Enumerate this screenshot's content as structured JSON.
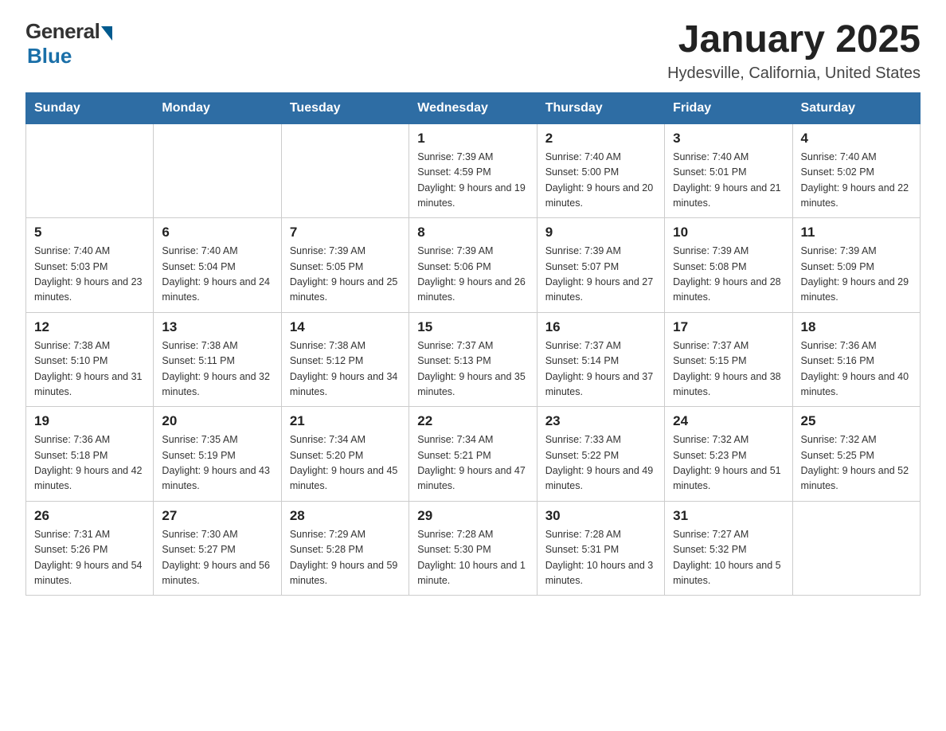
{
  "logo": {
    "general": "General",
    "blue": "Blue"
  },
  "title": "January 2025",
  "subtitle": "Hydesville, California, United States",
  "weekdays": [
    "Sunday",
    "Monday",
    "Tuesday",
    "Wednesday",
    "Thursday",
    "Friday",
    "Saturday"
  ],
  "weeks": [
    [
      null,
      null,
      null,
      {
        "day": "1",
        "sunrise": "Sunrise: 7:39 AM",
        "sunset": "Sunset: 4:59 PM",
        "daylight": "Daylight: 9 hours and 19 minutes."
      },
      {
        "day": "2",
        "sunrise": "Sunrise: 7:40 AM",
        "sunset": "Sunset: 5:00 PM",
        "daylight": "Daylight: 9 hours and 20 minutes."
      },
      {
        "day": "3",
        "sunrise": "Sunrise: 7:40 AM",
        "sunset": "Sunset: 5:01 PM",
        "daylight": "Daylight: 9 hours and 21 minutes."
      },
      {
        "day": "4",
        "sunrise": "Sunrise: 7:40 AM",
        "sunset": "Sunset: 5:02 PM",
        "daylight": "Daylight: 9 hours and 22 minutes."
      }
    ],
    [
      {
        "day": "5",
        "sunrise": "Sunrise: 7:40 AM",
        "sunset": "Sunset: 5:03 PM",
        "daylight": "Daylight: 9 hours and 23 minutes."
      },
      {
        "day": "6",
        "sunrise": "Sunrise: 7:40 AM",
        "sunset": "Sunset: 5:04 PM",
        "daylight": "Daylight: 9 hours and 24 minutes."
      },
      {
        "day": "7",
        "sunrise": "Sunrise: 7:39 AM",
        "sunset": "Sunset: 5:05 PM",
        "daylight": "Daylight: 9 hours and 25 minutes."
      },
      {
        "day": "8",
        "sunrise": "Sunrise: 7:39 AM",
        "sunset": "Sunset: 5:06 PM",
        "daylight": "Daylight: 9 hours and 26 minutes."
      },
      {
        "day": "9",
        "sunrise": "Sunrise: 7:39 AM",
        "sunset": "Sunset: 5:07 PM",
        "daylight": "Daylight: 9 hours and 27 minutes."
      },
      {
        "day": "10",
        "sunrise": "Sunrise: 7:39 AM",
        "sunset": "Sunset: 5:08 PM",
        "daylight": "Daylight: 9 hours and 28 minutes."
      },
      {
        "day": "11",
        "sunrise": "Sunrise: 7:39 AM",
        "sunset": "Sunset: 5:09 PM",
        "daylight": "Daylight: 9 hours and 29 minutes."
      }
    ],
    [
      {
        "day": "12",
        "sunrise": "Sunrise: 7:38 AM",
        "sunset": "Sunset: 5:10 PM",
        "daylight": "Daylight: 9 hours and 31 minutes."
      },
      {
        "day": "13",
        "sunrise": "Sunrise: 7:38 AM",
        "sunset": "Sunset: 5:11 PM",
        "daylight": "Daylight: 9 hours and 32 minutes."
      },
      {
        "day": "14",
        "sunrise": "Sunrise: 7:38 AM",
        "sunset": "Sunset: 5:12 PM",
        "daylight": "Daylight: 9 hours and 34 minutes."
      },
      {
        "day": "15",
        "sunrise": "Sunrise: 7:37 AM",
        "sunset": "Sunset: 5:13 PM",
        "daylight": "Daylight: 9 hours and 35 minutes."
      },
      {
        "day": "16",
        "sunrise": "Sunrise: 7:37 AM",
        "sunset": "Sunset: 5:14 PM",
        "daylight": "Daylight: 9 hours and 37 minutes."
      },
      {
        "day": "17",
        "sunrise": "Sunrise: 7:37 AM",
        "sunset": "Sunset: 5:15 PM",
        "daylight": "Daylight: 9 hours and 38 minutes."
      },
      {
        "day": "18",
        "sunrise": "Sunrise: 7:36 AM",
        "sunset": "Sunset: 5:16 PM",
        "daylight": "Daylight: 9 hours and 40 minutes."
      }
    ],
    [
      {
        "day": "19",
        "sunrise": "Sunrise: 7:36 AM",
        "sunset": "Sunset: 5:18 PM",
        "daylight": "Daylight: 9 hours and 42 minutes."
      },
      {
        "day": "20",
        "sunrise": "Sunrise: 7:35 AM",
        "sunset": "Sunset: 5:19 PM",
        "daylight": "Daylight: 9 hours and 43 minutes."
      },
      {
        "day": "21",
        "sunrise": "Sunrise: 7:34 AM",
        "sunset": "Sunset: 5:20 PM",
        "daylight": "Daylight: 9 hours and 45 minutes."
      },
      {
        "day": "22",
        "sunrise": "Sunrise: 7:34 AM",
        "sunset": "Sunset: 5:21 PM",
        "daylight": "Daylight: 9 hours and 47 minutes."
      },
      {
        "day": "23",
        "sunrise": "Sunrise: 7:33 AM",
        "sunset": "Sunset: 5:22 PM",
        "daylight": "Daylight: 9 hours and 49 minutes."
      },
      {
        "day": "24",
        "sunrise": "Sunrise: 7:32 AM",
        "sunset": "Sunset: 5:23 PM",
        "daylight": "Daylight: 9 hours and 51 minutes."
      },
      {
        "day": "25",
        "sunrise": "Sunrise: 7:32 AM",
        "sunset": "Sunset: 5:25 PM",
        "daylight": "Daylight: 9 hours and 52 minutes."
      }
    ],
    [
      {
        "day": "26",
        "sunrise": "Sunrise: 7:31 AM",
        "sunset": "Sunset: 5:26 PM",
        "daylight": "Daylight: 9 hours and 54 minutes."
      },
      {
        "day": "27",
        "sunrise": "Sunrise: 7:30 AM",
        "sunset": "Sunset: 5:27 PM",
        "daylight": "Daylight: 9 hours and 56 minutes."
      },
      {
        "day": "28",
        "sunrise": "Sunrise: 7:29 AM",
        "sunset": "Sunset: 5:28 PM",
        "daylight": "Daylight: 9 hours and 59 minutes."
      },
      {
        "day": "29",
        "sunrise": "Sunrise: 7:28 AM",
        "sunset": "Sunset: 5:30 PM",
        "daylight": "Daylight: 10 hours and 1 minute."
      },
      {
        "day": "30",
        "sunrise": "Sunrise: 7:28 AM",
        "sunset": "Sunset: 5:31 PM",
        "daylight": "Daylight: 10 hours and 3 minutes."
      },
      {
        "day": "31",
        "sunrise": "Sunrise: 7:27 AM",
        "sunset": "Sunset: 5:32 PM",
        "daylight": "Daylight: 10 hours and 5 minutes."
      },
      null
    ]
  ]
}
